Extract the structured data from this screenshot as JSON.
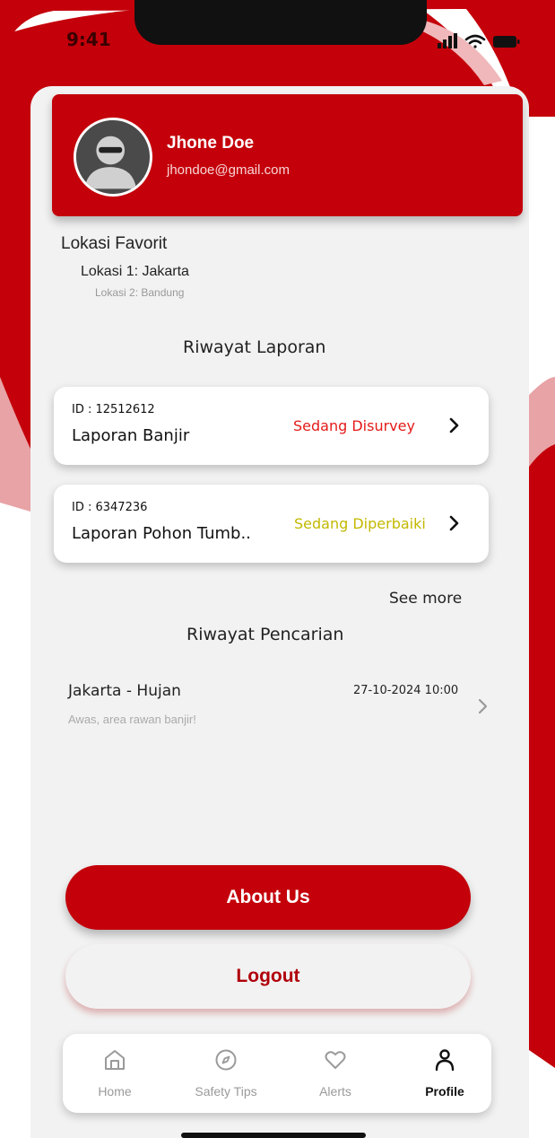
{
  "status_bar": {
    "time": "9:41"
  },
  "profile": {
    "name": "Jhone Doe",
    "email": "jhondoe@gmail.com"
  },
  "favorites": {
    "title": "Lokasi Favorit",
    "items": [
      "Lokasi 1: Jakarta",
      "Lokasi 2: Bandung"
    ]
  },
  "reports": {
    "title": "Riwayat Laporan",
    "items": [
      {
        "id": "ID : 12512612",
        "title": "Laporan Banjir",
        "status": "Sedang Disurvey"
      },
      {
        "id": "ID : 6347236",
        "title": "Laporan Pohon Tumb..",
        "status": "Sedang Diperbaiki"
      }
    ],
    "see_more": "See more"
  },
  "search_history": {
    "title": "Riwayat Pencarian",
    "items": [
      {
        "title": "Jakarta - Hujan",
        "subtitle": "Awas, area rawan banjir!",
        "time": "27-10-2024 10:00"
      }
    ]
  },
  "buttons": {
    "about": "About Us",
    "logout": "Logout"
  },
  "nav": {
    "items": [
      {
        "label": "Home",
        "icon": "home-icon"
      },
      {
        "label": "Safety Tips",
        "icon": "compass-icon"
      },
      {
        "label": "Alerts",
        "icon": "heart-icon"
      },
      {
        "label": "Profile",
        "icon": "user-icon",
        "active": true
      }
    ]
  },
  "colors": {
    "brand": "#c4000a",
    "status_survey": "#e51a1a",
    "status_perbaiki": "#c2b800",
    "background": "#f2f2f2"
  }
}
